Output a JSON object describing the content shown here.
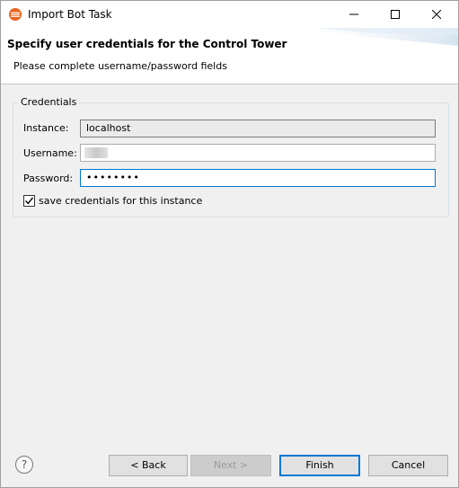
{
  "window": {
    "title": "Import Bot Task"
  },
  "banner": {
    "title": "Specify user credentials for the Control Tower",
    "description": "Please complete username/password fields"
  },
  "credentials": {
    "group_label": "Credentials",
    "instance_label": "Instance:",
    "instance_value": "localhost",
    "username_label": "Username:",
    "username_value": "",
    "password_label": "Password:",
    "password_value": "••••••••",
    "save_checkbox_label": "save credentials for this instance",
    "save_checked": true
  },
  "buttons": {
    "help": "?",
    "back": "< Back",
    "next": "Next >",
    "finish": "Finish",
    "cancel": "Cancel"
  },
  "colors": {
    "focus": "#0078d7",
    "background": "#f0f0f0"
  }
}
